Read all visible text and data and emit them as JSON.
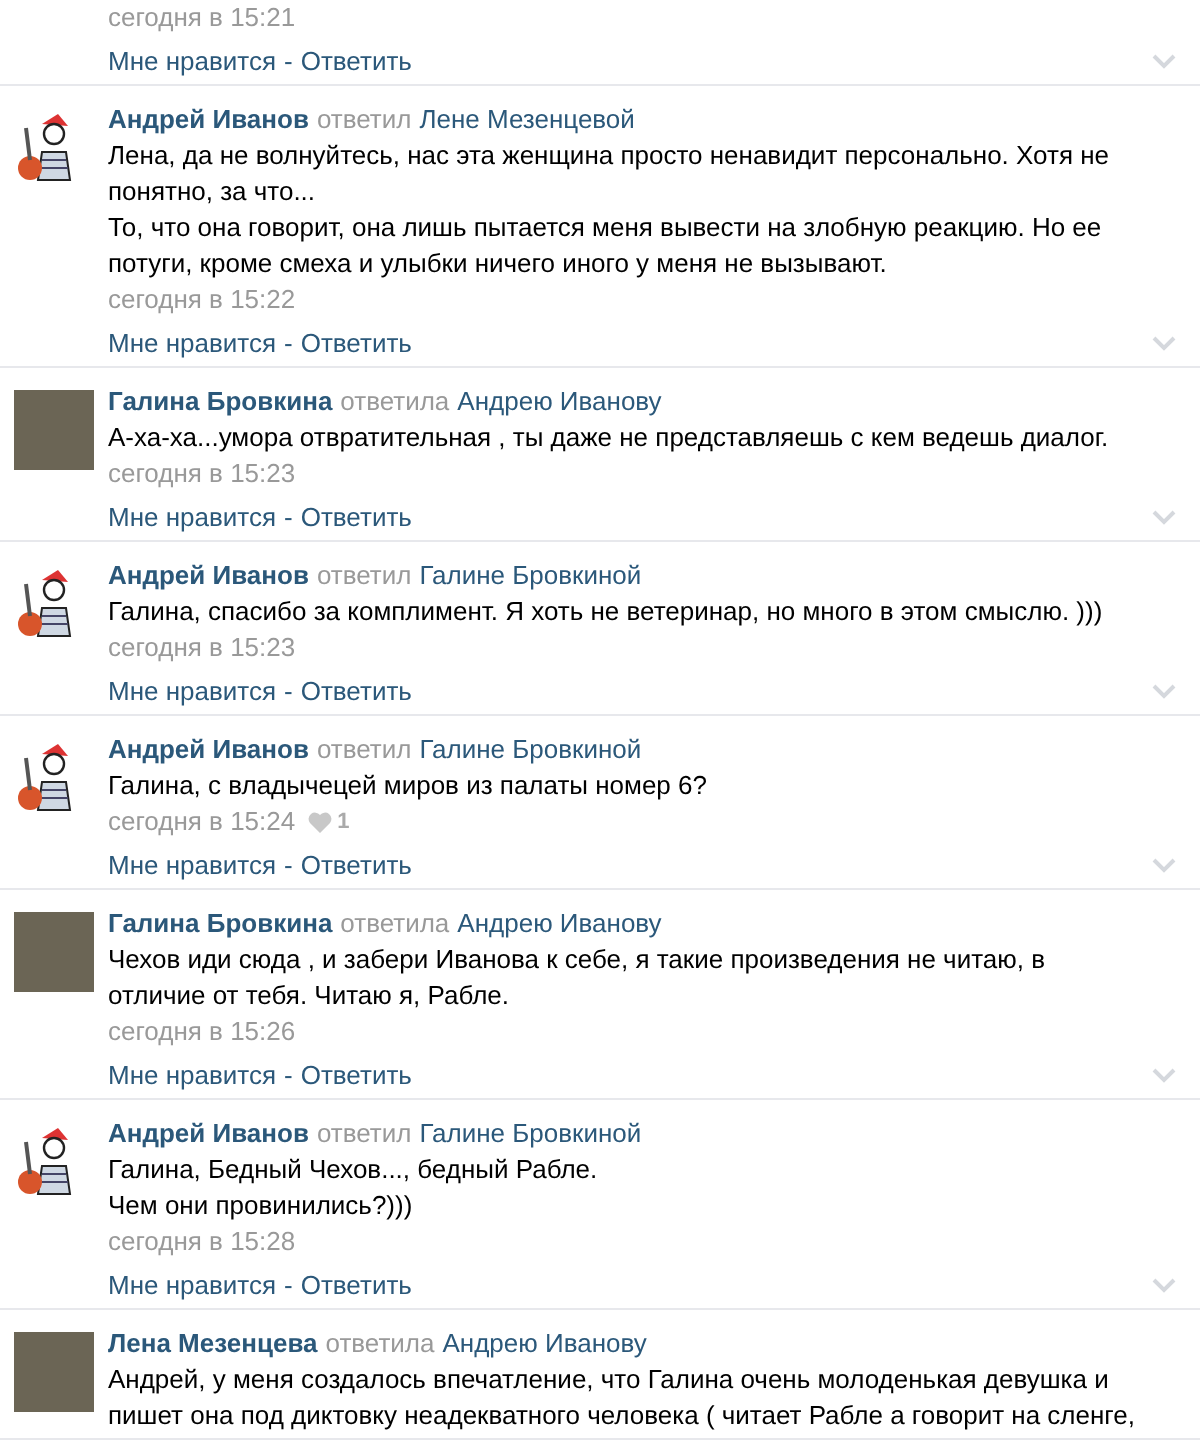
{
  "comments": [
    {
      "time": "сегодня в 15:21",
      "like_label": "Мне нравится",
      "separator": "-",
      "reply_label": "Ответить"
    },
    {
      "kind": "drawing",
      "author": "Андрей Иванов",
      "verb": "ответил",
      "addressee": "Лене Мезенцевой",
      "paragraphs": [
        "Лена, да не волнуйтесь, нас эта женщина просто ненавидит персонально. Хотя не понятно, за что...",
        "То, что она говорит, она лишь пытается меня вывести на злобную реакцию. Но ее потуги, кроме смеха и улыбки ничего иного у меня не вызывают."
      ],
      "time": "сегодня в 15:22",
      "like_label": "Мне нравится",
      "separator": "-",
      "reply_label": "Ответить"
    },
    {
      "kind": "photo",
      "author": "Галина Бровкина",
      "verb": "ответила",
      "addressee": "Андрею Иванову",
      "paragraphs": [
        "А-ха-ха...умора отвратительная , ты даже не представляешь с кем ведешь диалог."
      ],
      "time": "сегодня в 15:23",
      "like_label": "Мне нравится",
      "separator": "-",
      "reply_label": "Ответить"
    },
    {
      "kind": "drawing",
      "author": "Андрей Иванов",
      "verb": "ответил",
      "addressee": "Галине Бровкиной",
      "paragraphs": [
        "Галина, спасибо за комплимент. Я хоть не ветеринар, но много в этом смыслю. )))"
      ],
      "time": "сегодня в 15:23",
      "like_label": "Мне нравится",
      "separator": "-",
      "reply_label": "Ответить"
    },
    {
      "kind": "drawing",
      "author": "Андрей Иванов",
      "verb": "ответил",
      "addressee": "Галине Бровкиной",
      "paragraphs": [
        "Галина, с владычецей миров из палаты номер 6?"
      ],
      "time": "сегодня в 15:24",
      "likes": "1",
      "like_label": "Мне нравится",
      "separator": "-",
      "reply_label": "Ответить"
    },
    {
      "kind": "photo",
      "author": "Галина Бровкина",
      "verb": "ответила",
      "addressee": "Андрею Иванову",
      "paragraphs": [
        "Чехов иди сюда , и забери Иванова к себе, я такие произведения не читаю, в отличие от тебя. Читаю я, Рабле."
      ],
      "time": "сегодня в 15:26",
      "like_label": "Мне нравится",
      "separator": "-",
      "reply_label": "Ответить"
    },
    {
      "kind": "drawing",
      "author": "Андрей Иванов",
      "verb": "ответил",
      "addressee": "Галине Бровкиной",
      "paragraphs": [
        "Галина, Бедный Чехов..., бедный Рабле.",
        "Чем они провинились?)))"
      ],
      "time": "сегодня в 15:28",
      "like_label": "Мне нравится",
      "separator": "-",
      "reply_label": "Ответить"
    },
    {
      "kind": "photo",
      "author": "Лена Мезенцева",
      "verb": "ответила",
      "addressee": "Андрею Иванову",
      "paragraphs": [
        "Андрей, у меня создалось впечатление, что Галина очень молоденькая девушка и пишет она под диктовку неадекватного человека ( читает Рабле а говорит на сленге,"
      ]
    }
  ]
}
